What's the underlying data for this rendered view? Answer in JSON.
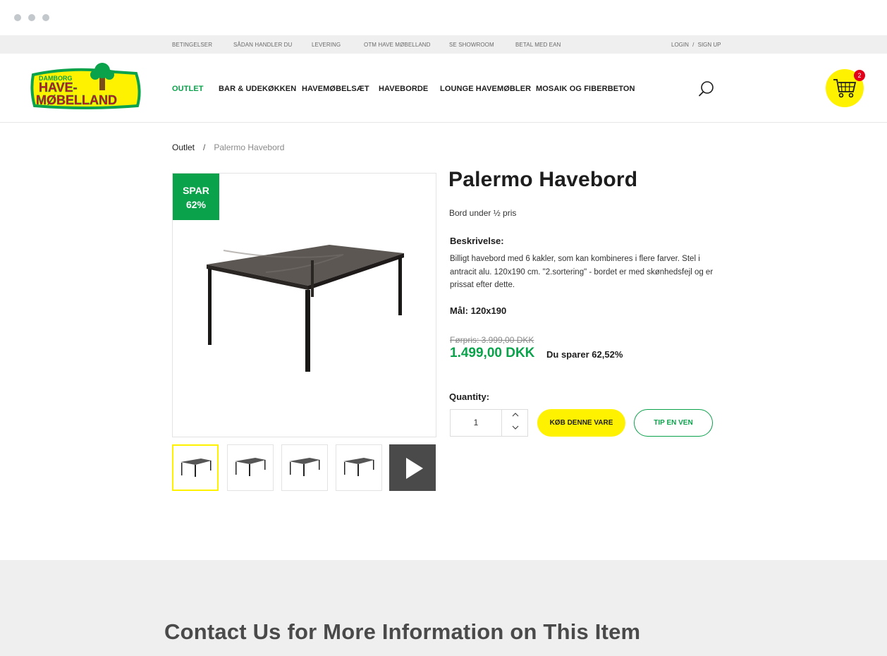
{
  "topbar": {
    "links": [
      "BETINGELSER",
      "SÅDAN HANDLER DU",
      "LEVERING",
      "OTM HAVE MØBELLAND",
      "SE SHOWROOM",
      "BETAL MED EAN"
    ],
    "login": "LOGIN",
    "login_sep": "/",
    "signup": "SIGN UP"
  },
  "brand": {
    "top": "DAMBORG",
    "line1": "HAVE-",
    "line2": "MØBELLAND",
    "colors": {
      "yellow": "#fff200",
      "green": "#0aa24b",
      "red": "#e2001a"
    }
  },
  "nav": [
    "OUTLET",
    "BAR & UDEKØKKEN",
    "HAVEMØBELSÆT",
    "HAVEBORDE",
    "LOUNGE HAVEMØBLER",
    "MOSAIK OG FIBERBETON"
  ],
  "cart": {
    "count": "2",
    "icon": "cart-icon"
  },
  "breadcrumb": {
    "parent": "Outlet",
    "sep": "/",
    "current": "Palermo Havebord"
  },
  "product": {
    "badge_line1": "SPAR",
    "badge_line2": "62%",
    "title": "Palermo Havebord",
    "subtitle": "Bord under ½ pris",
    "desc_label": "Beskrivelse:",
    "desc_text": "Billigt havebord med 6 kakler, som kan kombineres i flere farver. Stel i antracit alu. 120x190 cm. \"2.sortering\" - bordet er med skønhedsfejl og er prissat efter dette.",
    "measure": "Mål: 120x190",
    "old_price": "Førpris: 3.999,00 DKK",
    "new_price": "1.499,00 DKK",
    "saving": "Du sparer 62,52%",
    "qty_label": "Quantity:",
    "qty_value": "1",
    "buy_label": "KØB DENNE VARE",
    "tip_label": "TIP EN VEN"
  },
  "contact": {
    "heading": "Contact Us for More Information on This Item"
  }
}
